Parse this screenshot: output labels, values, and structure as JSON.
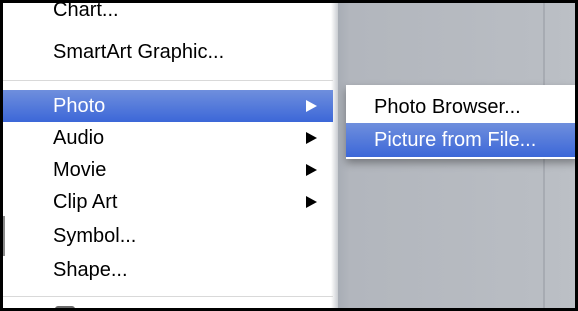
{
  "main_menu": {
    "items": [
      {
        "label": "Chart...",
        "has_submenu": false,
        "selected": false
      },
      {
        "label": "SmartArt Graphic...",
        "has_submenu": false,
        "selected": false
      },
      {
        "label": "Photo",
        "has_submenu": true,
        "selected": true
      },
      {
        "label": "Audio",
        "has_submenu": true,
        "selected": false
      },
      {
        "label": "Movie",
        "has_submenu": true,
        "selected": false
      },
      {
        "label": "Clip Art",
        "has_submenu": true,
        "selected": false
      },
      {
        "label": "Symbol...",
        "has_submenu": false,
        "selected": false
      },
      {
        "label": "Shape...",
        "has_submenu": false,
        "selected": false
      }
    ]
  },
  "photo_submenu": {
    "items": [
      {
        "label": "Photo Browser...",
        "selected": false
      },
      {
        "label": "Picture from File...",
        "selected": true
      }
    ]
  },
  "colors": {
    "selection": "#3c67d8",
    "menu_background": "#ffffff",
    "document_background": "#b9bdc3"
  }
}
